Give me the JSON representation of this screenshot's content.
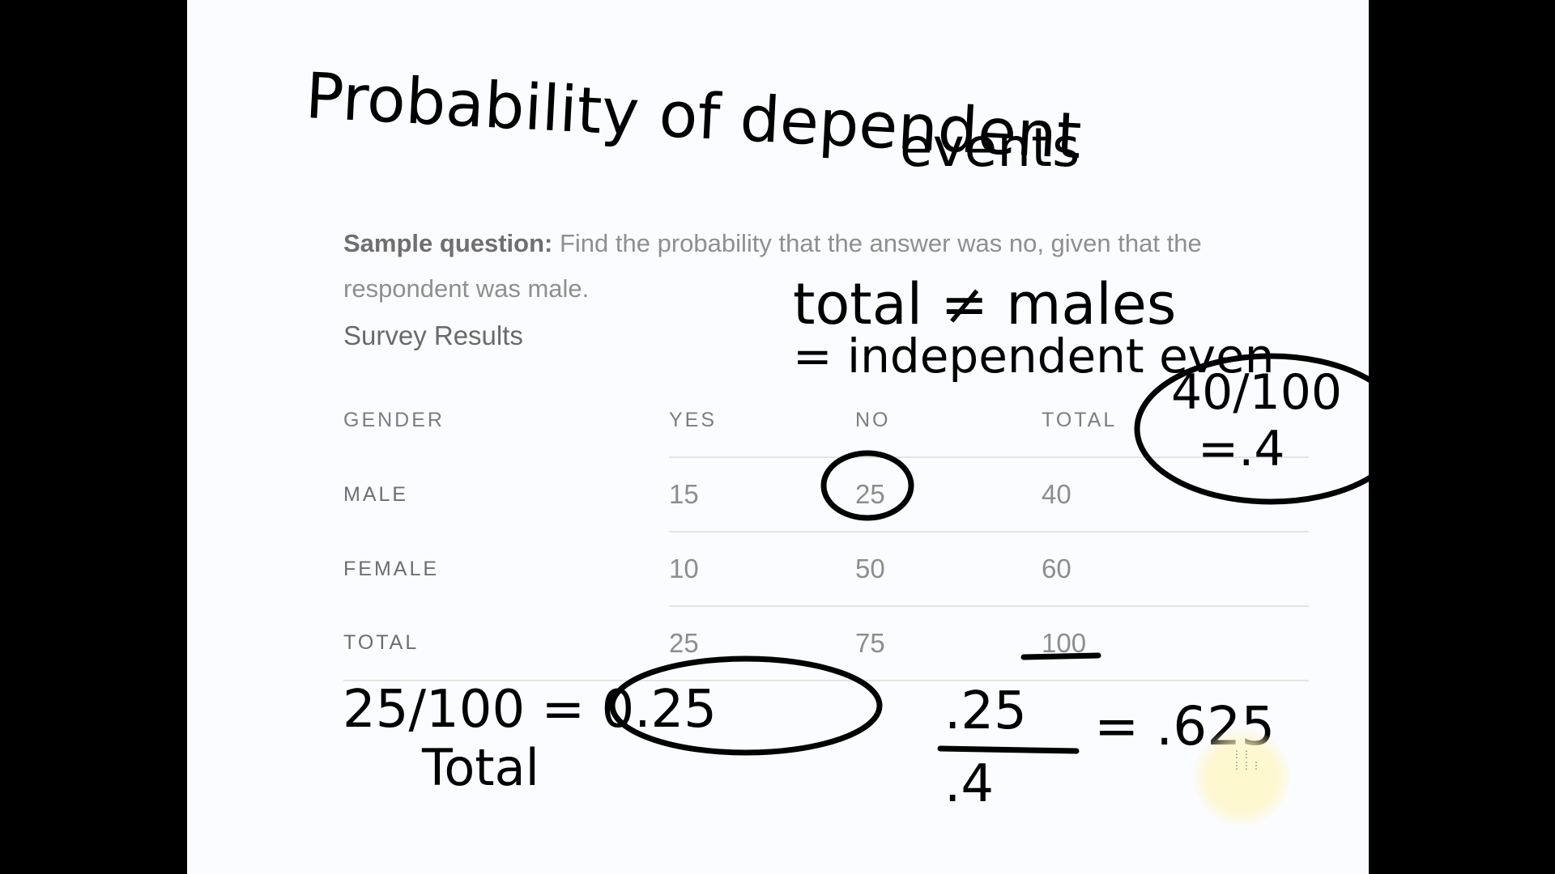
{
  "handwriting": {
    "title_line1": "Probability of dependent",
    "title_line2": "events",
    "note_line1": "total ≠ males",
    "note_line2": "= independent even",
    "circle_calc_line1": "40/100",
    "circle_calc_line2": "=.4",
    "bottom_left_calc": "25/100 = 0.25",
    "bottom_left_label": "Total",
    "fraction_numerator": ".25",
    "fraction_denominator": ".4",
    "fraction_result": "= .625"
  },
  "question": {
    "label": "Sample question:",
    "text": " Find the probability that the answer was no, given that the respondent was male."
  },
  "survey_title": "Survey Results",
  "table": {
    "headers": [
      "GENDER",
      "YES",
      "NO",
      "TOTAL"
    ],
    "rows": [
      {
        "label": "MALE",
        "yes": "15",
        "no": "25",
        "total": "40"
      },
      {
        "label": "FEMALE",
        "yes": "10",
        "no": "50",
        "total": "60"
      },
      {
        "label": "TOTAL",
        "yes": "25",
        "no": "75",
        "total": "100"
      }
    ]
  },
  "colors": {
    "slide_background": "#fbfcff",
    "letterbox": "#000000",
    "ink": "#000000",
    "text_gray": "#8f8f8f"
  }
}
